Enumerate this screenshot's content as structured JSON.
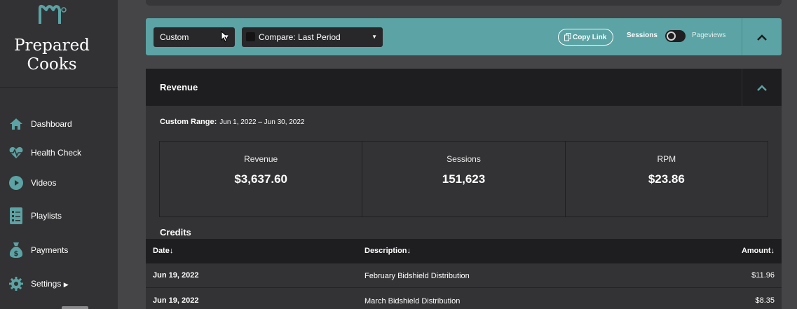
{
  "brand": {
    "line1": "Prepared",
    "line2": "Cooks"
  },
  "nav": [
    {
      "label": "Dashboard",
      "icon": "home-icon"
    },
    {
      "label": "Health Check",
      "icon": "heartbeat-icon"
    },
    {
      "label": "Videos",
      "icon": "play-icon"
    },
    {
      "label": "Playlists",
      "icon": "list-icon"
    },
    {
      "label": "Payments",
      "icon": "money-bag-icon"
    },
    {
      "label": "Settings",
      "icon": "gear-icon"
    }
  ],
  "filters": {
    "range_select": "Custom",
    "compare_select": "Compare: Last Period",
    "copy_link": "Copy Link",
    "toggle_left": "Sessions",
    "toggle_right": "Pageviews"
  },
  "revenue": {
    "title": "Revenue",
    "range_label": "Custom Range:",
    "range_value": "Jun 1, 2022 – Jun 30, 2022",
    "stats": [
      {
        "label": "Revenue",
        "value": "$3,637.60"
      },
      {
        "label": "Sessions",
        "value": "151,623"
      },
      {
        "label": "RPM",
        "value": "$23.86"
      }
    ]
  },
  "credits": {
    "title": "Credits",
    "columns": {
      "date": "Date",
      "description": "Description",
      "amount": "Amount"
    },
    "rows": [
      {
        "date": "Jun 19, 2022",
        "description": "February Bidshield Distribution",
        "amount": "$11.96"
      },
      {
        "date": "Jun 19, 2022",
        "description": "March Bidshield Distribution",
        "amount": "$8.35"
      }
    ]
  },
  "colors": {
    "accent": "#5ba3a4",
    "sidebar": "#323133",
    "background": "#454446",
    "panel": "#333234",
    "header": "#1e1d1f"
  }
}
